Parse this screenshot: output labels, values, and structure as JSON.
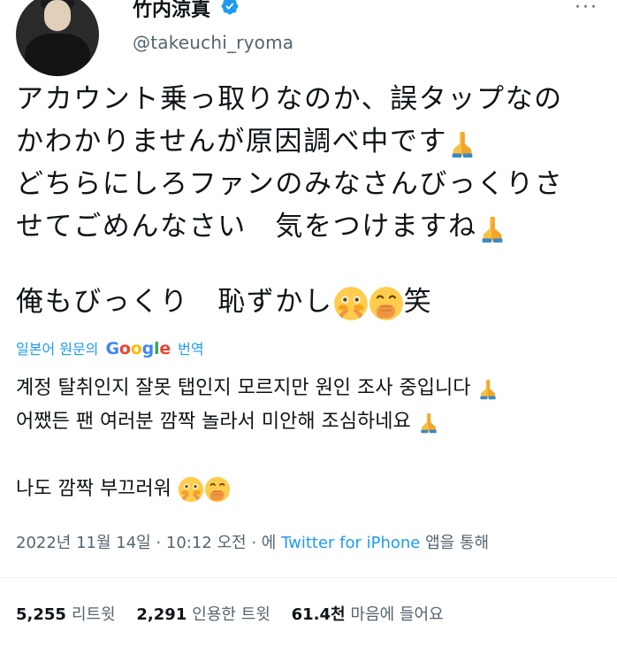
{
  "author": {
    "display_name": "竹内涼真",
    "handle": "@takeuchi_ryoma",
    "verified": true,
    "verified_color": "#1d9bf0"
  },
  "tweet": {
    "lines": [
      "アカウント乗っ取りなのか、誤タップなの",
      "かわかりませんが原因調べ中です",
      "どちらにしろファンのみなさんびっくりさ",
      "せてごめんなさい　気をつけますね",
      "俺もびっくり　恥ずかし",
      "笑"
    ]
  },
  "translation": {
    "prefix": "일본어 원문의",
    "google_letters": [
      "G",
      "o",
      "o",
      "g",
      "l",
      "e"
    ],
    "suffix": "번역",
    "lines": [
      "계정 탈취인지 잘못 탭인지 모르지만 원인 조사 중입니다",
      "어쨌든 팬 여러분 깜짝 놀라서 미안해 조심하네요",
      "나도 깜짝 부끄러워"
    ]
  },
  "timestamp": {
    "date_time": "2022년 11월 14일 · 10:12 오전 · 에",
    "source": "Twitter for iPhone",
    "suffix": "앱을 통해"
  },
  "stats": {
    "retweets_count": "5,255",
    "retweets_label": "리트윗",
    "quotes_count": "2,291",
    "quotes_label": "인용한 트윗",
    "likes_count": "61.4천",
    "likes_label": "마음에 들어요"
  },
  "icons": {
    "verified": "verified-badge-icon",
    "more": "more-icon",
    "pray": "folded-hands-icon",
    "flushed": "flushed-face-icon",
    "hand_over_mouth": "hand-over-mouth-icon"
  }
}
